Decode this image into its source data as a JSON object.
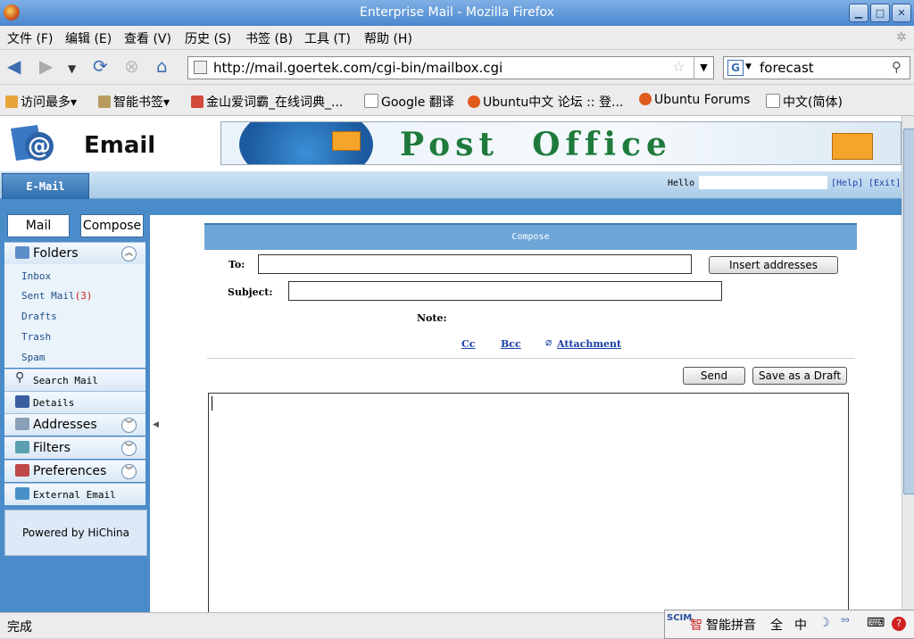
{
  "window": {
    "title": "Enterprise Mail - Mozilla Firefox"
  },
  "menu": [
    "文件 (F)",
    "编辑 (E)",
    "查看 (V)",
    "历史 (S)",
    "书签 (B)",
    "工具 (T)",
    "帮助 (H)"
  ],
  "nav": {
    "url": "http://mail.goertek.com/cgi-bin/mailbox.cgi",
    "search_value": "forecast",
    "search_engine": "G"
  },
  "bookmarks": [
    "访问最多",
    "智能书签",
    "金山爱词霸_在线词典_...",
    "Google 翻译",
    "Ubuntu中文 论坛 :: 登...",
    "Ubuntu Forums",
    "中文(简体)"
  ],
  "header": {
    "logo": "Email",
    "banner_text": "Post  Office",
    "tab": "E-Mail",
    "hello": "Hello",
    "help": "[Help]",
    "exit": "[Exit]"
  },
  "sidebar": {
    "mail_btn": "Mail",
    "compose_btn": "Compose",
    "folders_label": "Folders",
    "folders": [
      "Inbox",
      "Sent Mail",
      "Drafts",
      "Trash",
      "Spam"
    ],
    "sent_count": "(3)",
    "search_mail": "Search Mail",
    "details": "Details",
    "addresses": "Addresses",
    "filters": "Filters",
    "preferences": "Preferences",
    "external_email": "External Email",
    "powered": "Powered by HiChina"
  },
  "compose": {
    "heading": "Compose",
    "to_label": "To:",
    "insert_addresses": "Insert addresses",
    "subject_label": "Subject:",
    "note_label": "Note:",
    "cc": "Cc",
    "bcc": "Bcc",
    "attachment": "Attachment",
    "send": "Send",
    "save_draft": "Save as a Draft"
  },
  "status": {
    "text": "完成"
  },
  "ime": {
    "logo": "SCIM",
    "mode": "智能拼音",
    "full": "全",
    "lang": "中"
  },
  "colors": {
    "titlebar": "#4a86cf",
    "accent": "#4a8cc9",
    "compose_header": "#6ea6d8"
  }
}
